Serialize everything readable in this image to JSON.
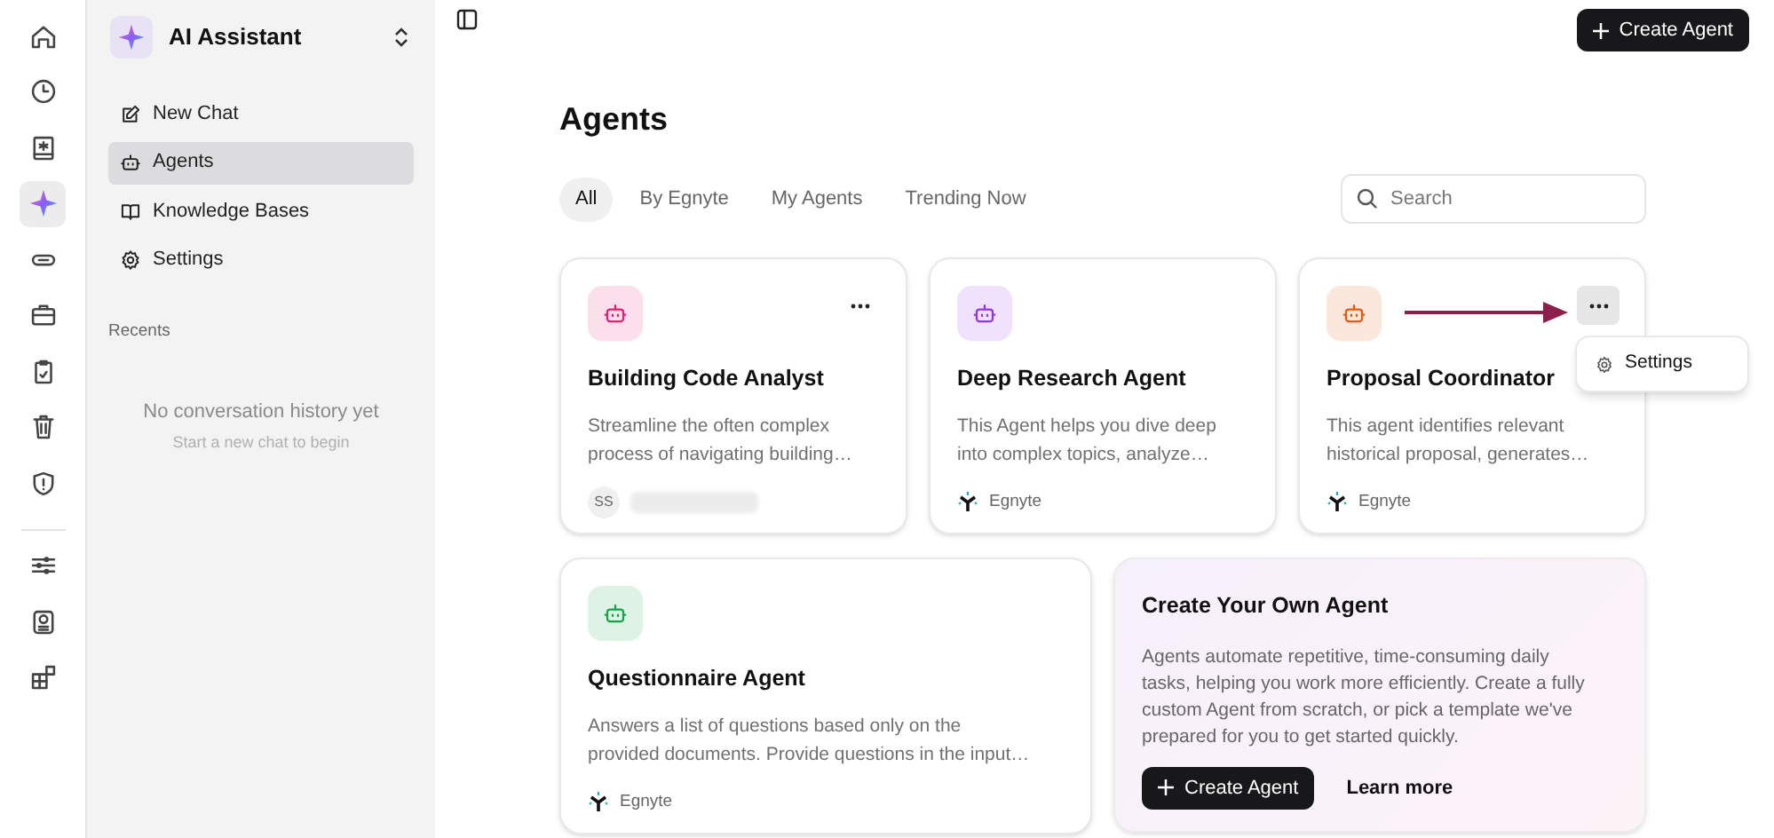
{
  "rail": {
    "top": [
      {
        "kind": "home",
        "selected": false
      },
      {
        "kind": "clock",
        "selected": false
      },
      {
        "kind": "document",
        "selected": false
      },
      {
        "kind": "sparkle",
        "selected": true
      },
      {
        "kind": "link",
        "selected": false
      },
      {
        "kind": "briefcase",
        "selected": false
      },
      {
        "kind": "clipboard",
        "selected": false
      },
      {
        "kind": "trash",
        "selected": false
      },
      {
        "kind": "shield",
        "selected": false
      }
    ],
    "bottom": [
      {
        "kind": "sliders",
        "selected": false
      },
      {
        "kind": "badge",
        "selected": false
      },
      {
        "kind": "apps",
        "selected": false
      }
    ]
  },
  "sidebar": {
    "workspace": "AI Assistant",
    "items": [
      {
        "kind": "edit",
        "label": "New Chat",
        "selected": false
      },
      {
        "kind": "bot",
        "label": "Agents",
        "selected": true
      },
      {
        "kind": "book",
        "label": "Knowledge Bases",
        "selected": false
      },
      {
        "kind": "gear",
        "label": "Settings",
        "selected": false
      }
    ],
    "recents_heading": "Recents",
    "empty_title": "No conversation history yet",
    "empty_hint": "Start a new chat to begin"
  },
  "header": {
    "create_button": "Create Agent"
  },
  "page": {
    "title": "Agents",
    "tabs": [
      {
        "label": "All",
        "selected": true
      },
      {
        "label": "By Egnyte",
        "selected": false
      },
      {
        "label": "My Agents",
        "selected": false
      },
      {
        "label": "Trending Now",
        "selected": false
      }
    ],
    "search": {
      "placeholder": "Search"
    }
  },
  "cards": [
    {
      "kind": "agent",
      "title": "Building Code Analyst",
      "description": "Streamline the often complex\nprocess of navigating building…",
      "color": "#e11d74",
      "author": {
        "kind": "user",
        "initials": "SS",
        "name_hidden": true
      },
      "menu": {
        "open": false
      }
    },
    {
      "kind": "agent",
      "title": "Deep Research Agent",
      "description": "This Agent helps you dive deep\ninto complex topics, analyze…",
      "color": "#9333ea",
      "author": {
        "kind": "egnyte",
        "name": "Egnyte"
      }
    },
    {
      "kind": "agent",
      "title": "Proposal Coordinator",
      "description": "This agent identifies relevant\nhistorical proposal, generates…",
      "color": "#ea580c",
      "author": {
        "kind": "egnyte",
        "name": "Egnyte"
      },
      "menu": {
        "open": true,
        "items": [
          "Settings"
        ]
      },
      "annotation_arrow": true
    },
    {
      "kind": "agent",
      "title": "Questionnaire Agent",
      "description": "Answers a list of questions based only on the\nprovided documents. Provide questions in the input…",
      "color": "#16a34a",
      "author": {
        "kind": "egnyte",
        "name": "Egnyte"
      }
    },
    {
      "kind": "create",
      "title": "Create Your Own Agent",
      "description": "Agents automate repetitive, time-consuming daily\ntasks, helping you work more efficiently. Create a fully\ncustom Agent from scratch, or pick a template we've\nprepared for you to get started quickly.",
      "primary": "Create Agent",
      "secondary": "Learn more"
    }
  ]
}
